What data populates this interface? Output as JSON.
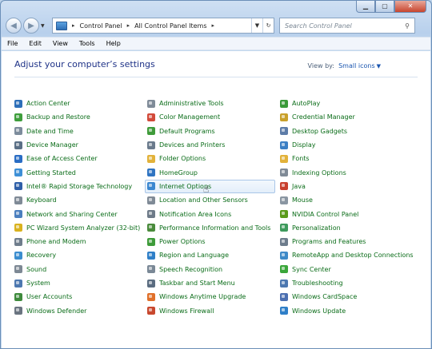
{
  "address": {
    "crumbs": [
      "Control Panel",
      "All Control Panel Items"
    ],
    "search_placeholder": "Search Control Panel"
  },
  "menu": [
    "File",
    "Edit",
    "View",
    "Tools",
    "Help"
  ],
  "heading": "Adjust your computer’s settings",
  "view_by": {
    "label": "View by:",
    "value": "Small icons"
  },
  "columns": [
    [
      {
        "label": "Action Center",
        "icon": "flag-icon",
        "color": "#2d6fb9"
      },
      {
        "label": "Backup and Restore",
        "icon": "backup-icon",
        "color": "#3e9e3c"
      },
      {
        "label": "Date and Time",
        "icon": "clock-icon",
        "color": "#7d8c9c"
      },
      {
        "label": "Device Manager",
        "icon": "device-manager-icon",
        "color": "#5a6f86"
      },
      {
        "label": "Ease of Access Center",
        "icon": "ease-of-access-icon",
        "color": "#2a6dc4"
      },
      {
        "label": "Getting Started",
        "icon": "getting-started-icon",
        "color": "#3d8fd6"
      },
      {
        "label": "Intel® Rapid Storage Technology",
        "icon": "intel-icon",
        "color": "#2f5fa8"
      },
      {
        "label": "Keyboard",
        "icon": "keyboard-icon",
        "color": "#7f8a96"
      },
      {
        "label": "Network and Sharing Center",
        "icon": "network-icon",
        "color": "#4b7fbf"
      },
      {
        "label": "PC Wizard System Analyzer (32-bit)",
        "icon": "pc-wizard-icon",
        "color": "#d9b21f"
      },
      {
        "label": "Phone and Modem",
        "icon": "phone-icon",
        "color": "#6f7d8c"
      },
      {
        "label": "Recovery",
        "icon": "recovery-icon",
        "color": "#3b8dcf"
      },
      {
        "label": "Sound",
        "icon": "speaker-icon",
        "color": "#7d8894"
      },
      {
        "label": "System",
        "icon": "system-icon",
        "color": "#4d78b0"
      },
      {
        "label": "User Accounts",
        "icon": "user-accounts-icon",
        "color": "#3e8a3c"
      },
      {
        "label": "Windows Defender",
        "icon": "defender-icon",
        "color": "#6a7480"
      }
    ],
    [
      {
        "label": "Administrative Tools",
        "icon": "admin-tools-icon",
        "color": "#7f8b98"
      },
      {
        "label": "Color Management",
        "icon": "color-management-icon",
        "color": "#d24a3a"
      },
      {
        "label": "Default Programs",
        "icon": "default-programs-icon",
        "color": "#3f9b3a"
      },
      {
        "label": "Devices and Printers",
        "icon": "printer-icon",
        "color": "#6a7a8c"
      },
      {
        "label": "Folder Options",
        "icon": "folder-icon",
        "color": "#e2b23a"
      },
      {
        "label": "HomeGroup",
        "icon": "homegroup-icon",
        "color": "#2f74c2"
      },
      {
        "label": "Internet Options",
        "icon": "internet-options-icon",
        "color": "#3a86d0"
      },
      {
        "label": "Location and Other Sensors",
        "icon": "sensor-icon",
        "color": "#7f8a96"
      },
      {
        "label": "Notification Area Icons",
        "icon": "notification-icon",
        "color": "#6d7a88"
      },
      {
        "label": "Performance Information and Tools",
        "icon": "performance-icon",
        "color": "#4a8b3c"
      },
      {
        "label": "Power Options",
        "icon": "power-icon",
        "color": "#3e9b3a"
      },
      {
        "label": "Region and Language",
        "icon": "globe-icon",
        "color": "#2f7fc8"
      },
      {
        "label": "Speech Recognition",
        "icon": "microphone-icon",
        "color": "#7a8896"
      },
      {
        "label": "Taskbar and Start Menu",
        "icon": "taskbar-icon",
        "color": "#5a6c80"
      },
      {
        "label": "Windows Anytime Upgrade",
        "icon": "windows-logo-icon",
        "color": "#e0702a"
      },
      {
        "label": "Windows Firewall",
        "icon": "firewall-icon",
        "color": "#c8482e"
      }
    ],
    [
      {
        "label": "AutoPlay",
        "icon": "autoplay-icon",
        "color": "#3b9a3a"
      },
      {
        "label": "Credential Manager",
        "icon": "credential-icon",
        "color": "#c8a02a"
      },
      {
        "label": "Desktop Gadgets",
        "icon": "gadgets-icon",
        "color": "#5d7ca8"
      },
      {
        "label": "Display",
        "icon": "display-icon",
        "color": "#3c7fc4"
      },
      {
        "label": "Fonts",
        "icon": "fonts-icon",
        "color": "#e2b23a"
      },
      {
        "label": "Indexing Options",
        "icon": "indexing-icon",
        "color": "#7f8a96"
      },
      {
        "label": "Java",
        "icon": "java-icon",
        "color": "#c8402e"
      },
      {
        "label": "Mouse",
        "icon": "mouse-icon",
        "color": "#8a96a2"
      },
      {
        "label": "NVIDIA Control Panel",
        "icon": "nvidia-icon",
        "color": "#5a9a1a"
      },
      {
        "label": "Personalization",
        "icon": "personalization-icon",
        "color": "#3e9a5c"
      },
      {
        "label": "Programs and Features",
        "icon": "programs-icon",
        "color": "#6d7c8c"
      },
      {
        "label": "RemoteApp and Desktop Connections",
        "icon": "remoteapp-icon",
        "color": "#3f8ac8"
      },
      {
        "label": "Sync Center",
        "icon": "sync-icon",
        "color": "#3aa63a"
      },
      {
        "label": "Troubleshooting",
        "icon": "troubleshooting-icon",
        "color": "#4d78b0"
      },
      {
        "label": "Windows CardSpace",
        "icon": "cardspace-icon",
        "color": "#4b6fb0"
      },
      {
        "label": "Windows Update",
        "icon": "windows-update-icon",
        "color": "#2f7fc8"
      }
    ]
  ],
  "hovered_item": "Internet Options"
}
